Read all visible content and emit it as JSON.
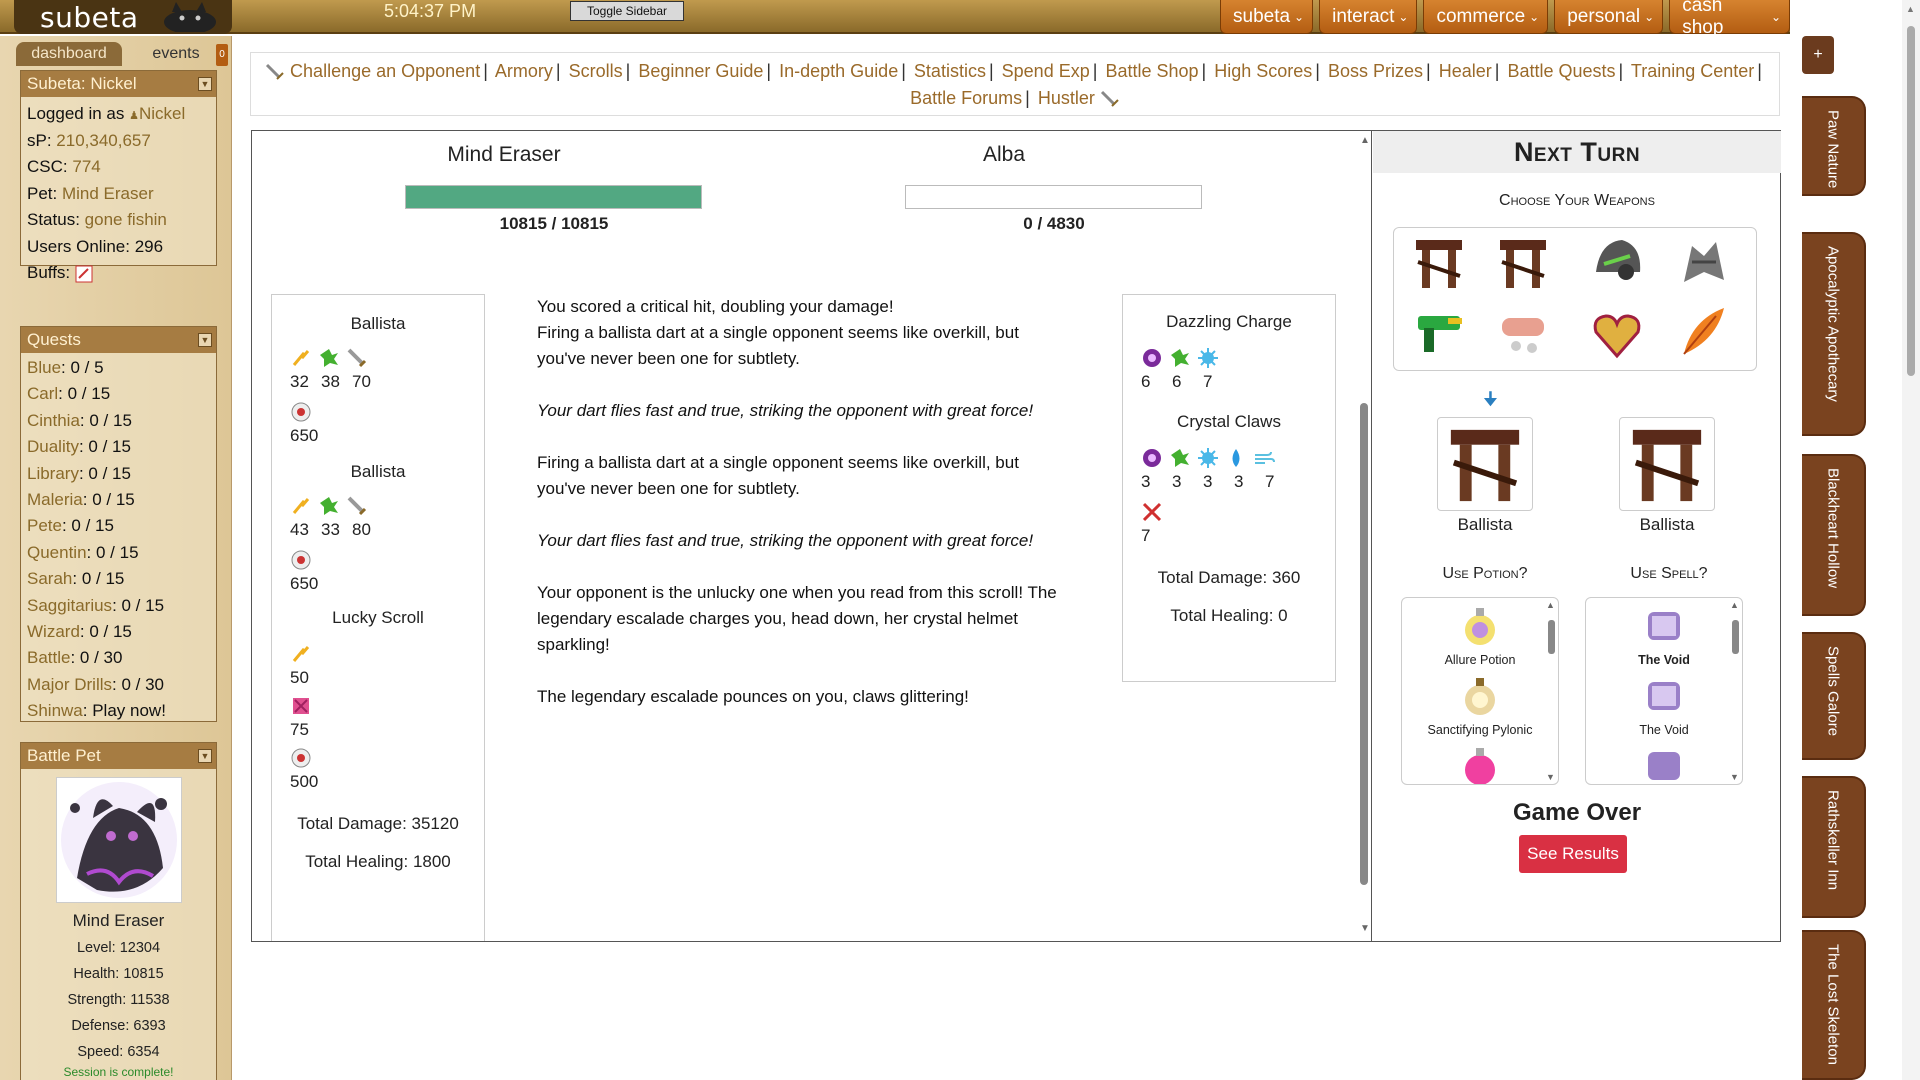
{
  "header": {
    "logo": "subeta",
    "clock": "5:04:37 PM",
    "toggle_sidebar": "Toggle Sidebar",
    "nav": [
      "subeta",
      "interact",
      "commerce",
      "personal",
      "cash shop"
    ]
  },
  "sidebar": {
    "tabs": {
      "dashboard": "dashboard",
      "events": "events",
      "badge": "0"
    },
    "user_panel": {
      "title": "Subeta: Nickel",
      "logged_in_label": "Logged in as",
      "username": "Nickel",
      "sp_label": "sP:",
      "sp_value": "210,340,657",
      "csc_label": "CSC:",
      "csc_value": "774",
      "pet_label": "Pet:",
      "pet_value": "Mind Eraser",
      "status_label": "Status:",
      "status_value": "gone fishin",
      "online_label": "Users Online:",
      "online_value": "296",
      "buffs_label": "Buffs:"
    },
    "quests_panel": {
      "title": "Quests",
      "items": [
        {
          "name": "Blue",
          "value": ": 0 / 5"
        },
        {
          "name": "Carl",
          "value": ": 0 / 15"
        },
        {
          "name": "Cinthia",
          "value": ": 0 / 15"
        },
        {
          "name": "Duality",
          "value": ": 0 / 15"
        },
        {
          "name": "Library",
          "value": ": 0 / 15"
        },
        {
          "name": "Maleria",
          "value": ": 0 / 15"
        },
        {
          "name": "Pete",
          "value": ": 0 / 15"
        },
        {
          "name": "Quentin",
          "value": ": 0 / 15"
        },
        {
          "name": "Sarah",
          "value": ": 0 / 15"
        },
        {
          "name": "Saggitarius",
          "value": ": 0 / 15"
        },
        {
          "name": "Wizard",
          "value": ": 0 / 15"
        },
        {
          "name": "Battle",
          "value": ": 0 / 30"
        },
        {
          "name": "Major Drills",
          "value": ": 0 / 30"
        },
        {
          "name": "Shinwa",
          "value": ": Play now!"
        }
      ]
    },
    "battle_pet_panel": {
      "title": "Battle Pet",
      "name": "Mind Eraser",
      "level": "Level: 12304",
      "health": "Health: 10815",
      "strength": "Strength: 11538",
      "defense": "Defense: 6393",
      "speed": "Speed: 6354",
      "session": "Session is complete!"
    }
  },
  "subnav": {
    "links": [
      "Challenge an Opponent",
      "Armory",
      "Scrolls",
      "Beginner Guide",
      "In-depth Guide",
      "Statistics",
      "Spend Exp",
      "Battle Shop",
      "High Scores",
      "Boss Prizes",
      "Healer",
      "Battle Quests",
      "Training Center",
      "Battle Forums",
      "Hustler"
    ]
  },
  "battle": {
    "player": {
      "name": "Mind Eraser",
      "hp": "10815 / 10815",
      "hp_fraction": 1.0
    },
    "opponent": {
      "name": "Alba",
      "hp": "0 / 4830",
      "hp_fraction": 0.0
    },
    "player_items": [
      {
        "title": "Ballista",
        "values": [
          "32",
          "38",
          "70"
        ],
        "defense": "650"
      },
      {
        "title": "Ballista",
        "values": [
          "43",
          "33",
          "80"
        ],
        "defense": "650"
      },
      {
        "title": "Lucky Scroll",
        "v1": "50",
        "v2": "75",
        "v3": "500"
      }
    ],
    "player_total_damage": "Total Damage: 35120",
    "player_total_healing": "Total Healing: 1800",
    "log": [
      "You scored a critical hit, doubling your damage!",
      "Firing a ballista dart at a single opponent seems like overkill, but you've never been one for subtlety.",
      "Your dart flies fast and true, striking the opponent with great force!",
      "Firing a ballista dart at a single opponent seems like overkill, but you've never been one for subtlety.",
      "Your dart flies fast and true, striking the opponent with great force!",
      "Your opponent is the unlucky one when you read from this scroll! The legendary escalade charges you, head down, her crystal helmet sparkling!",
      "The legendary escalade pounces on you, claws glittering!"
    ],
    "opponent_items": [
      {
        "title": "Dazzling Charge",
        "values": [
          "6",
          "6",
          "7"
        ]
      },
      {
        "title": "Crystal Claws",
        "values": [
          "3",
          "3",
          "3",
          "3",
          "7"
        ],
        "extra": "7"
      }
    ],
    "opponent_total_damage": "Total Damage: 360",
    "opponent_total_healing": "Total Healing: 0"
  },
  "next_turn": {
    "title": "Next Turn",
    "choose_weapons": "Choose Your Weapons",
    "selected": [
      "Ballista",
      "Ballista"
    ],
    "use_potion": "Use Potion?",
    "use_spell": "Use Spell?",
    "potions": [
      "Allure Potion",
      "Sanctifying Pylonic"
    ],
    "spells": [
      "The Void",
      "The Void"
    ],
    "game_over": "Game Over",
    "see_results": "See Results"
  },
  "right_tabs": [
    "Paw Nature",
    "Apocalyptic Apothecary",
    "Blackheart Hollow",
    "Spells Galore",
    "Rathskeller Inn",
    "The Lost Skeleton"
  ],
  "colors": {
    "hp_fill": "#52a882",
    "accent_orange": "#c46d1e",
    "link_brown": "#9a6a2a",
    "danger_red": "#d93043"
  }
}
